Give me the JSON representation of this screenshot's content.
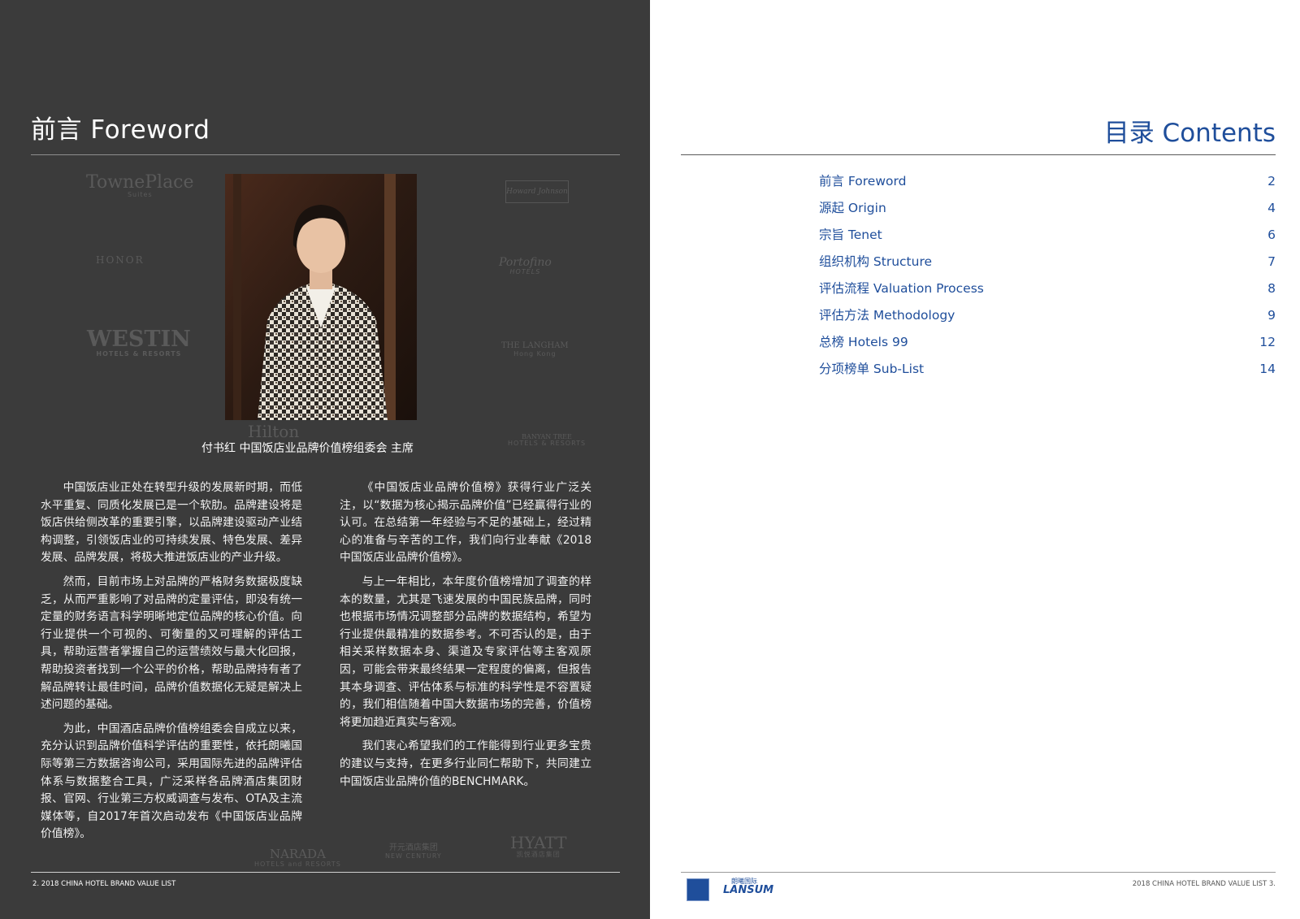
{
  "left_page": {
    "title": "前言 Foreword",
    "caption": "付书红  中国饭店业品牌价值榜组委会  主席",
    "watermarks": [
      {
        "name": "towneplace-logo",
        "line1": "TownePlace",
        "line2": "Suites"
      },
      {
        "name": "honor-logo",
        "line1": "HONOR",
        "line2": ""
      },
      {
        "name": "westin-logo",
        "line1": "WESTIN",
        "line2": "HOTELS & RESORTS"
      },
      {
        "name": "hilton-logo",
        "line1": "Hilton",
        "line2": ""
      },
      {
        "name": "langham-logo",
        "line1": "THE LANGHAM",
        "line2": "Hong Kong"
      },
      {
        "name": "banyan-tree-logo",
        "line1": "BANYAN TREE",
        "line2": "HOTELS & RESORTS"
      },
      {
        "name": "howard-johnson-logo",
        "line1": "Howard Johnson",
        "line2": ""
      },
      {
        "name": "portofino-logo",
        "line1": "Portofino",
        "line2": "HOTELS"
      },
      {
        "name": "hyatt-logo",
        "line1": "HYATT",
        "line2": "凯悦酒店集团"
      },
      {
        "name": "narada-logo",
        "line1": "NARADA",
        "line2": "HOTELS and RESORTS"
      },
      {
        "name": "new-century-logo",
        "line1": "开元酒店集团",
        "line2": "NEW CENTURY"
      }
    ],
    "col_left": [
      "中国饭店业正处在转型升级的发展新时期，而低水平重复、同质化发展已是一个软肋。品牌建设将是饭店供给侧改革的重要引擎，以品牌建设驱动产业结构调整，引领饭店业的可持续发展、特色发展、差异发展、品牌发展，将极大推进饭店业的产业升级。",
      "然而，目前市场上对品牌的严格财务数据极度缺乏，从而严重影响了对品牌的定量评估，即没有统一定量的财务语言科学明晰地定位品牌的核心价值。向行业提供一个可视的、可衡量的又可理解的评估工具，帮助运营者掌握自己的运营绩效与最大化回报，帮助投资者找到一个公平的价格，帮助品牌持有者了解品牌转让最佳时间，品牌价值数据化无疑是解决上述问题的基础。",
      "为此，中国酒店品牌价值榜组委会自成立以来，充分认识到品牌价值科学评估的重要性，依托朗曦国际等第三方数据咨询公司，采用国际先进的品牌评估体系与数据整合工具，广泛采样各品牌酒店集团财报、官网、行业第三方权威调查与发布、OTA及主流媒体等，自2017年首次启动发布《中国饭店业品牌价值榜》。"
    ],
    "col_right": [
      "《中国饭店业品牌价值榜》获得行业广泛关注，以“数据为核心揭示品牌价值”已经赢得行业的认可。在总结第一年经验与不足的基础上，经过精心的准备与辛苦的工作，我们向行业奉献《2018中国饭店业品牌价值榜》。",
      "与上一年相比，本年度价值榜增加了调查的样本的数量，尤其是飞速发展的中国民族品牌，同时也根据市场情况调整部分品牌的数据结构，希望为行业提供最精准的数据参考。不可否认的是，由于相关采样数据本身、渠道及专家评估等主客观原因，可能会带来最终结果一定程度的偏离，但报告其本身调查、评估体系与标准的科学性是不容置疑的，我们相信随着中国大数据市场的完善，价值榜将更加趋近真实与客观。",
      "我们衷心希望我们的工作能得到行业更多宝贵的建议与支持，在更多行业同仁帮助下，共同建立中国饭店业品牌价值的BENCHMARK。"
    ],
    "footer": "2.   2018 CHINA HOTEL BRAND VALUE LIST"
  },
  "right_page": {
    "title": "目录   Contents",
    "toc": [
      {
        "label": "前言  Foreword",
        "page": "2"
      },
      {
        "label": "源起  Origin",
        "page": "4"
      },
      {
        "label": "宗旨  Tenet",
        "page": "6"
      },
      {
        "label": "组织机构  Structure",
        "page": "7"
      },
      {
        "label": "评估流程  Valuation Process",
        "page": "8"
      },
      {
        "label": "评估方法  Methodology",
        "page": "9"
      },
      {
        "label": "总榜  Hotels 99",
        "page": "12"
      },
      {
        "label": "分项榜单  Sub-List",
        "page": "14"
      }
    ],
    "logo_text": "LANSUM",
    "logo_cn": "朗曦国际",
    "footer": "2018 CHINA HOTEL BRAND VALUE LIST   3."
  },
  "colors": {
    "dark_bg": "#3b3b3b",
    "accent_blue": "#1f4e9b"
  }
}
